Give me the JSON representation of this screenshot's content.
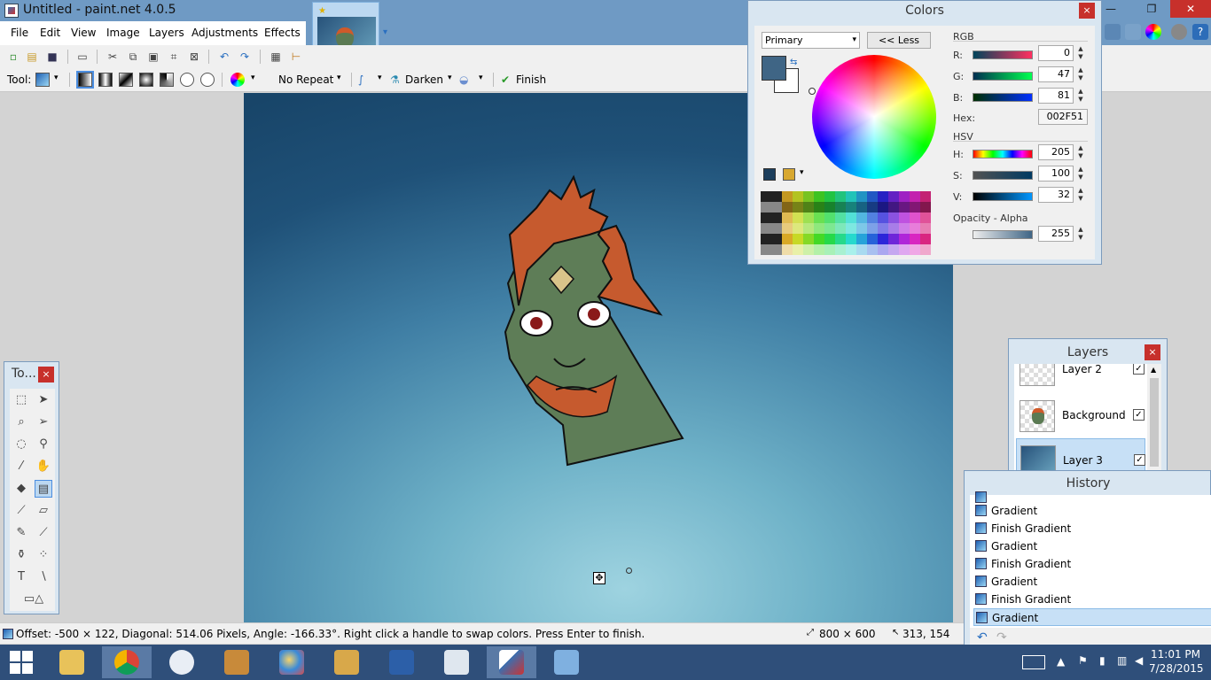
{
  "window": {
    "title": "Untitled - paint.net 4.0.5",
    "minimize": "—",
    "maximize": "❐",
    "close": "✕"
  },
  "menu": [
    "File",
    "Edit",
    "View",
    "Image",
    "Layers",
    "Adjustments",
    "Effects"
  ],
  "toolbar2": {
    "tool_label": "Tool:",
    "repeat_mode": "No Repeat",
    "blend_mode": "Darken",
    "finish_label": "Finish"
  },
  "colors_window": {
    "title": "Colors",
    "mode": "Primary",
    "less_button": "<< Less",
    "rgb_header": "RGB",
    "r_label": "R:",
    "r_value": "0",
    "g_label": "G:",
    "g_value": "47",
    "b_label": "B:",
    "b_value": "81",
    "hex_label": "Hex:",
    "hex_value": "002F51",
    "hsv_header": "HSV",
    "h_label": "H:",
    "h_value": "205",
    "s_label": "S:",
    "s_value": "100",
    "v_label": "V:",
    "v_value": "32",
    "alpha_header": "Opacity - Alpha",
    "alpha_value": "255",
    "primary_color": "#3f6585",
    "secondary_color": "#ffffff"
  },
  "tools_window": {
    "title": "To..."
  },
  "layers_window": {
    "title": "Layers",
    "layers": [
      {
        "name": "Layer 2",
        "visible": true,
        "selected": false
      },
      {
        "name": "Background",
        "visible": true,
        "selected": false
      },
      {
        "name": "Layer 3",
        "visible": true,
        "selected": true
      }
    ]
  },
  "history_window": {
    "title": "History",
    "items": [
      "Gradient",
      "Finish Gradient",
      "Gradient",
      "Finish Gradient",
      "Gradient",
      "Finish Gradient",
      "Gradient"
    ],
    "selected_index": 6
  },
  "status": {
    "message": "Offset: -500 × 122, Diagonal: 514.06 Pixels, Angle: -166.33°. Right click a handle to swap colors. Press Enter to finish.",
    "image_size": "800 × 600",
    "cursor_pos": "313, 154"
  },
  "taskbar": {
    "time": "11:01 PM",
    "date": "7/28/2015"
  },
  "icons": {
    "close": "×",
    "checked": "✓",
    "dropdown": "▾",
    "spin_up": "▲",
    "spin_down": "▼",
    "undo": "↶",
    "redo": "↷",
    "cut": "✂",
    "finish_check": "✔"
  }
}
